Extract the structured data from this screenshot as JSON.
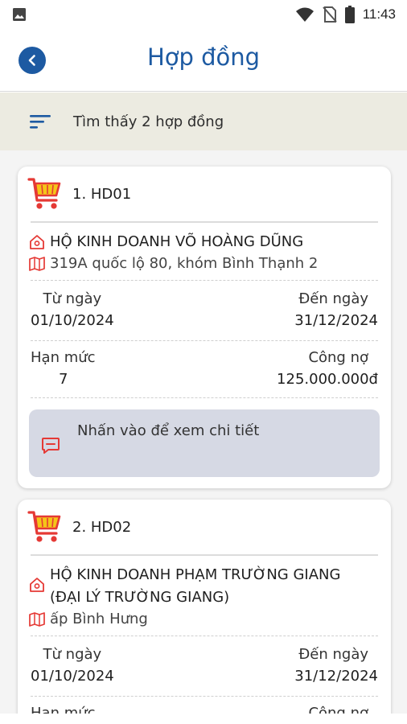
{
  "status": {
    "time": "11:43"
  },
  "header": {
    "title": "Hợp đồng"
  },
  "filter": {
    "result_text": "Tìm thấy 2 hợp đồng"
  },
  "contracts": [
    {
      "number": "1. HD01",
      "business": "HỘ KINH DOANH VÕ HOÀNG DŨNG",
      "address": "319A quốc lộ 80, khóm Bình Thạnh 2",
      "from_label": "Từ ngày",
      "from_value": "01/10/2024",
      "to_label": "Đến ngày",
      "to_value": "31/12/2024",
      "limit_label": "Hạn mức",
      "limit_value": "7",
      "debt_label": "Công nợ",
      "debt_value": "125.000.000đ",
      "detail_hint": "Nhấn vào để xem chi tiết"
    },
    {
      "number": "2. HD02",
      "business_line1": "HỘ KINH DOANH PHẠM TRƯỜNG GIANG",
      "business_line2": "(ĐẠI LÝ TRƯỜNG GIANG)",
      "address": "ấp Bình Hưng",
      "from_label": "Từ ngày",
      "from_value": "01/10/2024",
      "to_label": "Đến ngày",
      "to_value": "31/12/2024",
      "limit_label": "Hạn mức",
      "debt_label": "Công nợ"
    }
  ],
  "colors": {
    "primary": "#1d5aa2",
    "accent_red": "#e53935",
    "cart_yellow": "#f5c518",
    "filter_bg": "#ecebe1"
  },
  "icons": [
    "image-icon",
    "wifi-icon",
    "no-sim-icon",
    "battery-icon",
    "back-icon",
    "filter-icon",
    "cart-icon",
    "home-icon",
    "map-icon",
    "message-icon"
  ]
}
